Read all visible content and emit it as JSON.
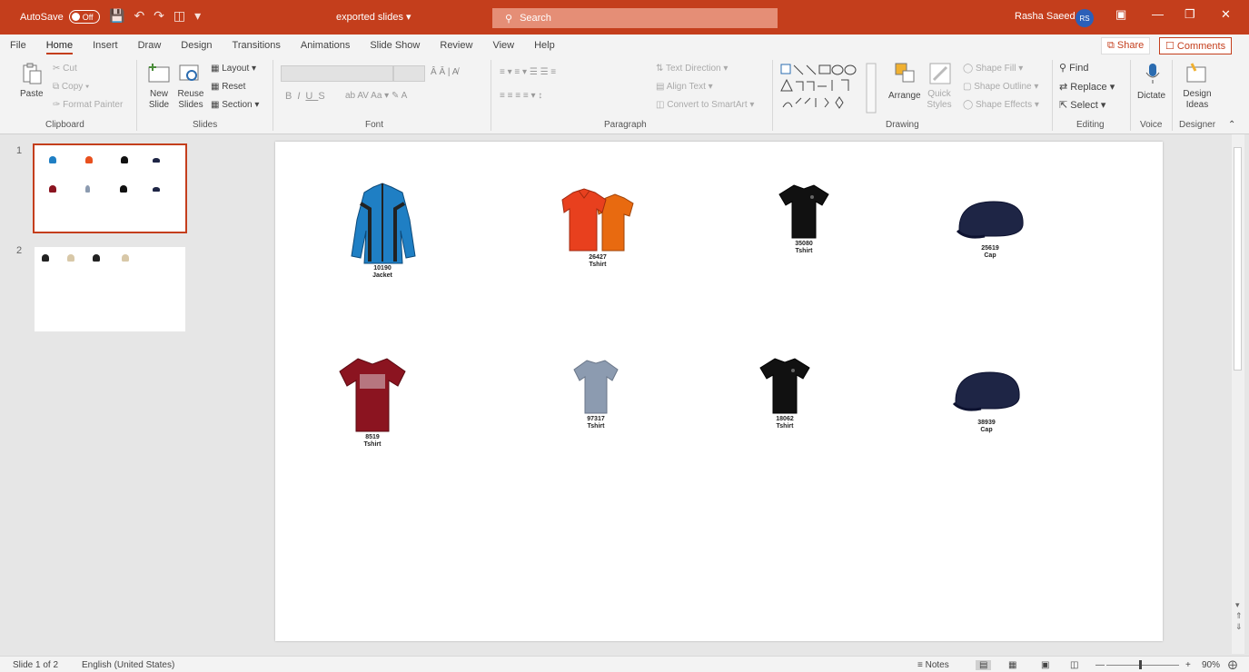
{
  "titlebar": {
    "autosave_label": "AutoSave",
    "autosave_state": "Off",
    "doc_title": "exported slides",
    "search_placeholder": "Search",
    "user_name": "Rasha Saeed",
    "user_initials": "RS"
  },
  "tabs": [
    "File",
    "Home",
    "Insert",
    "Draw",
    "Design",
    "Transitions",
    "Animations",
    "Slide Show",
    "Review",
    "View",
    "Help"
  ],
  "active_tab": "Home",
  "share_label": "Share",
  "comments_label": "Comments",
  "ribbon": {
    "clipboard": {
      "paste": "Paste",
      "cut": "Cut",
      "copy": "Copy",
      "format_painter": "Format Painter",
      "label": "Clipboard"
    },
    "slides": {
      "new_slide": "New Slide",
      "reuse_slides": "Reuse Slides",
      "layout": "Layout",
      "reset": "Reset",
      "section": "Section",
      "label": "Slides"
    },
    "font": {
      "label": "Font"
    },
    "paragraph": {
      "text_direction": "Text Direction",
      "align_text": "Align Text",
      "convert_smartart": "Convert to SmartArt",
      "label": "Paragraph"
    },
    "drawing": {
      "arrange": "Arrange",
      "quick_styles": "Quick Styles",
      "shape_fill": "Shape Fill",
      "shape_outline": "Shape Outline",
      "shape_effects": "Shape Effects",
      "label": "Drawing"
    },
    "editing": {
      "find": "Find",
      "replace": "Replace",
      "select": "Select",
      "label": "Editing"
    },
    "voice": {
      "dictate": "Dictate",
      "label": "Voice"
    },
    "designer": {
      "design_ideas": "Design Ideas",
      "label": "Designer"
    }
  },
  "thumbnails": [
    {
      "number": "1"
    },
    {
      "number": "2"
    }
  ],
  "products": [
    {
      "id": "10190",
      "name": "Jacket",
      "icon": "jacket-icon",
      "color": "#1f7fc4"
    },
    {
      "id": "26427",
      "name": "Tshirt",
      "icon": "polo-shirts-icon",
      "color": "#e8501e"
    },
    {
      "id": "35080",
      "name": "Tshirt",
      "icon": "tshirt-icon",
      "color": "#111111"
    },
    {
      "id": "25619",
      "name": "Cap",
      "icon": "cap-icon",
      "color": "#1e2545"
    },
    {
      "id": "8519",
      "name": "Tshirt",
      "icon": "tshirt-icon",
      "color": "#8b1420"
    },
    {
      "id": "97317",
      "name": "Tshirt",
      "icon": "tshirt-icon",
      "color": "#8c9bb0"
    },
    {
      "id": "18062",
      "name": "Tshirt",
      "icon": "tshirt-icon",
      "color": "#111111"
    },
    {
      "id": "38939",
      "name": "Cap",
      "icon": "cap-icon",
      "color": "#1e2545"
    }
  ],
  "status": {
    "slide_info": "Slide 1 of 2",
    "language": "English (United States)",
    "notes": "Notes",
    "zoom": "90%"
  }
}
